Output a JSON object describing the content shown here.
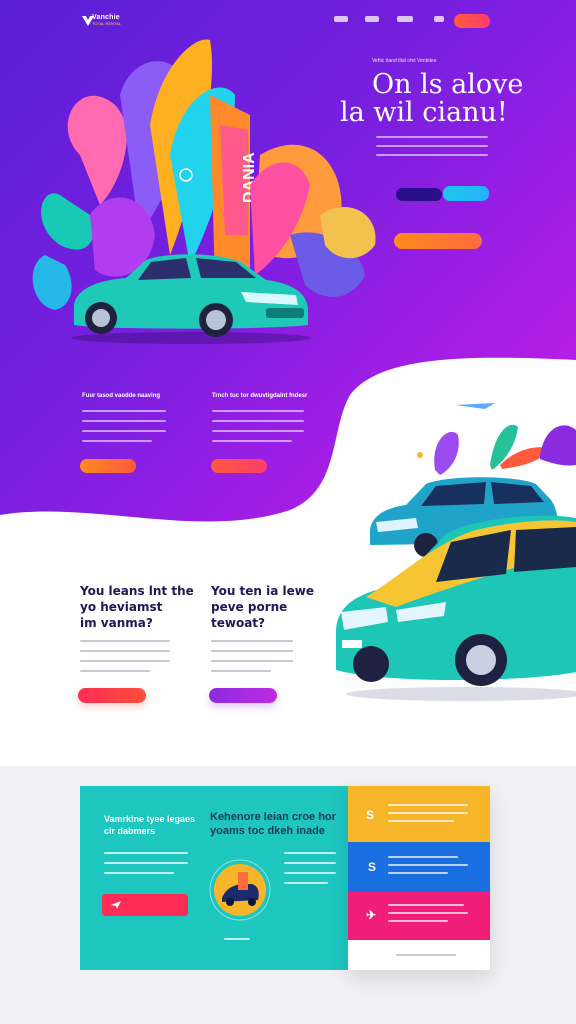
{
  "brand": {
    "logo_text": "Vanchie",
    "logo_sub": "TOTAL RENTAL"
  },
  "hero": {
    "kicker": "Vehic rland tital ofet Ventidee",
    "title_line1": "On ls alove",
    "title_line2": "la wil cianu!",
    "art_sign": "DANIA"
  },
  "features": [
    {
      "heading": "Fuur tasod vaodde naaving"
    },
    {
      "heading": "Trnch tuc tor dwuvtigdalnt fndesr"
    }
  ],
  "section2": {
    "left_title": [
      "You leans lnt the",
      "yo heviamst",
      "im vanma?"
    ],
    "right_title": [
      "You ten ia lewe",
      "peve porne",
      "tewoat?"
    ]
  },
  "bottom": {
    "teal_title": [
      "Vamrkine tyee legaes",
      "cir dabmers"
    ],
    "center_title": [
      "Kehenore leian croe hor",
      "yoams toc dkeh inade"
    ],
    "stack_icons": [
      "S",
      "S",
      "✈"
    ]
  },
  "colors": {
    "hero_start": "#5a1fd6",
    "hero_end": "#d21de0",
    "teal": "#1ec6c0",
    "accent_orange": "#ff8a1e",
    "accent_red": "#ff2d55",
    "accent_purple": "#8a2be2",
    "stack_yellow": "#f7b52a",
    "stack_blue": "#1a6fe0",
    "stack_pink": "#f01e78"
  }
}
